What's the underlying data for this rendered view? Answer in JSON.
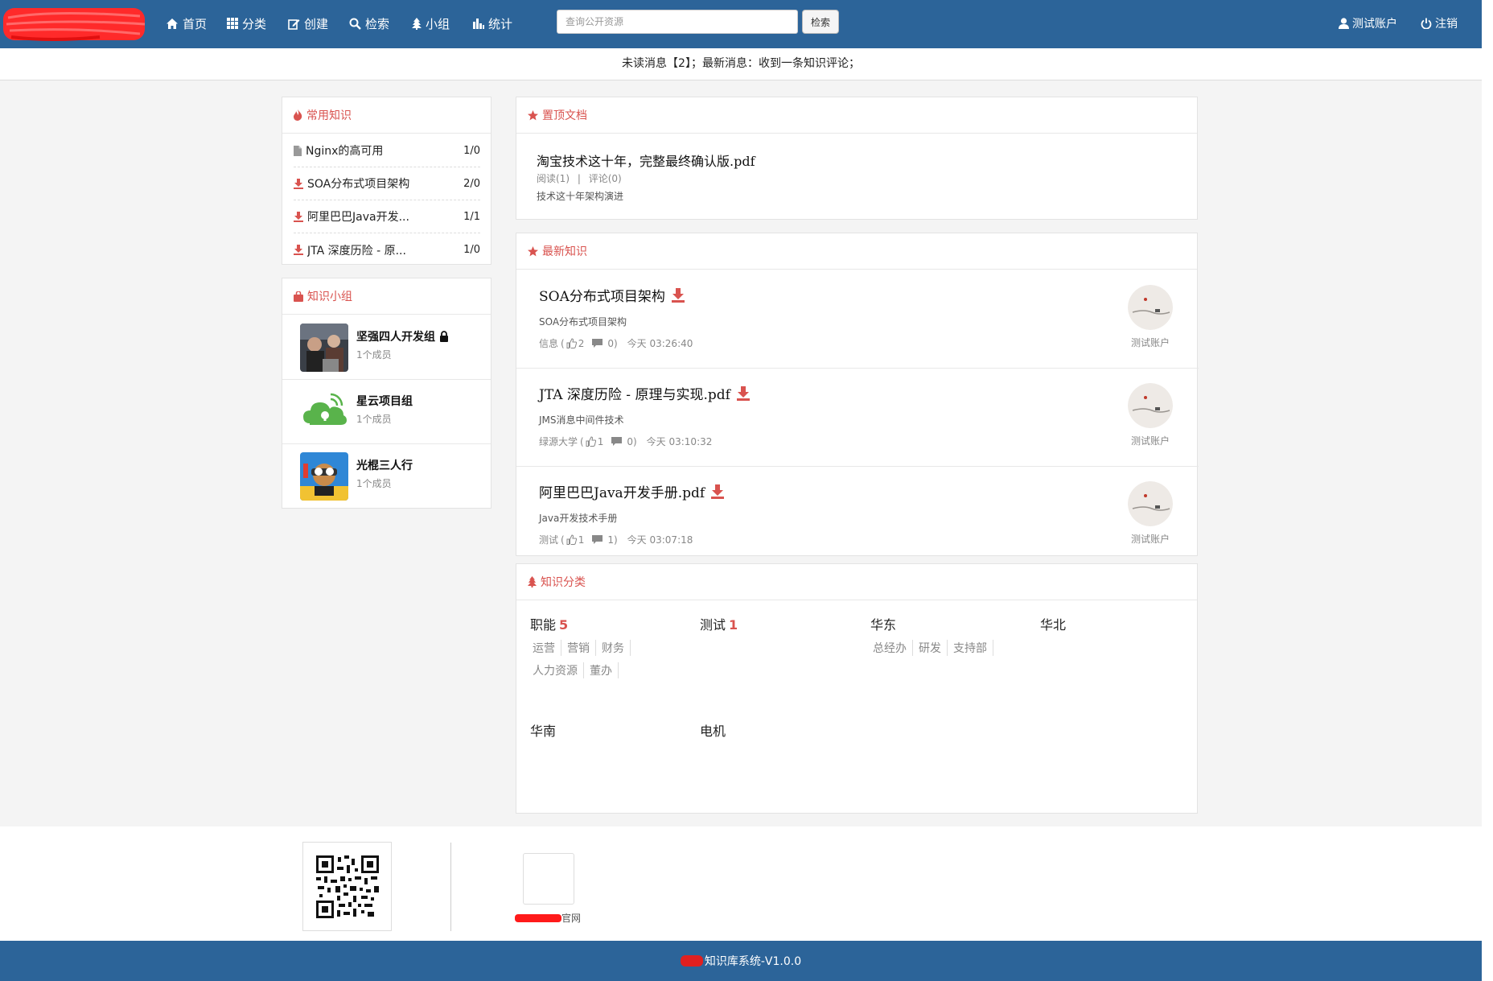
{
  "colors": {
    "navbar": "#2c6499",
    "accent_red": "#d9534f",
    "page_bg": "#f4f4f4"
  },
  "nav": {
    "items": [
      {
        "label": "首页",
        "icon": "home-icon"
      },
      {
        "label": "分类",
        "icon": "grid-icon"
      },
      {
        "label": "创建",
        "icon": "edit-icon"
      },
      {
        "label": "检索",
        "icon": "search-icon"
      },
      {
        "label": "小组",
        "icon": "tree-icon"
      },
      {
        "label": "统计",
        "icon": "bar-chart-icon"
      }
    ],
    "search": {
      "placeholder": "查询公开资源",
      "value": "",
      "button_label": "检索"
    },
    "user_label": "测试账户",
    "logout_label": "注销"
  },
  "notice": {
    "text": "未读消息【2】；最新消息：收到一条知识评论；"
  },
  "common_knowledge": {
    "title": "常用知识",
    "items": [
      {
        "icon": "file-icon",
        "title": "Nginx的高可用",
        "count": "1/0"
      },
      {
        "icon": "download-icon",
        "title": "SOA分布式项目架构",
        "count": "2/0"
      },
      {
        "icon": "download-icon",
        "title": "阿里巴巴Java开发...",
        "count": "1/1"
      },
      {
        "icon": "download-icon",
        "title": "JTA 深度历险 - 原...",
        "count": "1/0"
      }
    ]
  },
  "groups": {
    "title": "知识小组",
    "items": [
      {
        "name": "坚强四人开发组",
        "members": "1个成员",
        "locked": true
      },
      {
        "name": "星云项目组",
        "members": "1个成员",
        "locked": false
      },
      {
        "name": "光棍三人行",
        "members": "1个成员",
        "locked": false
      }
    ]
  },
  "pinned": {
    "title": "置顶文档",
    "doc": {
      "title": "淘宝技术这十年，完整最终确认版.pdf",
      "reads": "阅读(1)",
      "sep": "|",
      "comments": "评论(0)",
      "desc": "技术这十年架构演进"
    }
  },
  "latest": {
    "title": "最新知识",
    "items": [
      {
        "title": "SOA分布式项目架构",
        "desc": "SOA分布式项目架构",
        "category": "信息",
        "likes": "2",
        "comments": "0",
        "time": "今天 03:26:40",
        "author": "测试账户"
      },
      {
        "title": "JTA 深度历险 - 原理与实现.pdf",
        "desc": "JMS消息中间件技术",
        "category": "绿源大学",
        "likes": "1",
        "comments": "0",
        "time": "今天 03:10:32",
        "author": "测试账户"
      },
      {
        "title": "阿里巴巴Java开发手册.pdf",
        "desc": "Java开发技术手册",
        "category": "测试",
        "likes": "1",
        "comments": "1",
        "time": "今天 03:07:18",
        "author": "测试账户"
      }
    ]
  },
  "categories": {
    "title": "知识分类",
    "groups": [
      {
        "name": "职能",
        "count": "5",
        "subs": [
          "运营",
          "营销",
          "财务",
          "人力资源",
          "董办"
        ]
      },
      {
        "name": "测试",
        "count": "1",
        "subs": []
      },
      {
        "name": "华东",
        "count": "",
        "subs": [
          "总经办",
          "研发",
          "支持部"
        ]
      },
      {
        "name": "华北",
        "count": "",
        "subs": []
      },
      {
        "name": "华南",
        "count": "",
        "subs": []
      },
      {
        "name": "电机",
        "count": "",
        "subs": []
      }
    ]
  },
  "footer": {
    "site_link_suffix": "官网",
    "bar_text": "知识库系统-V1.0.0"
  }
}
